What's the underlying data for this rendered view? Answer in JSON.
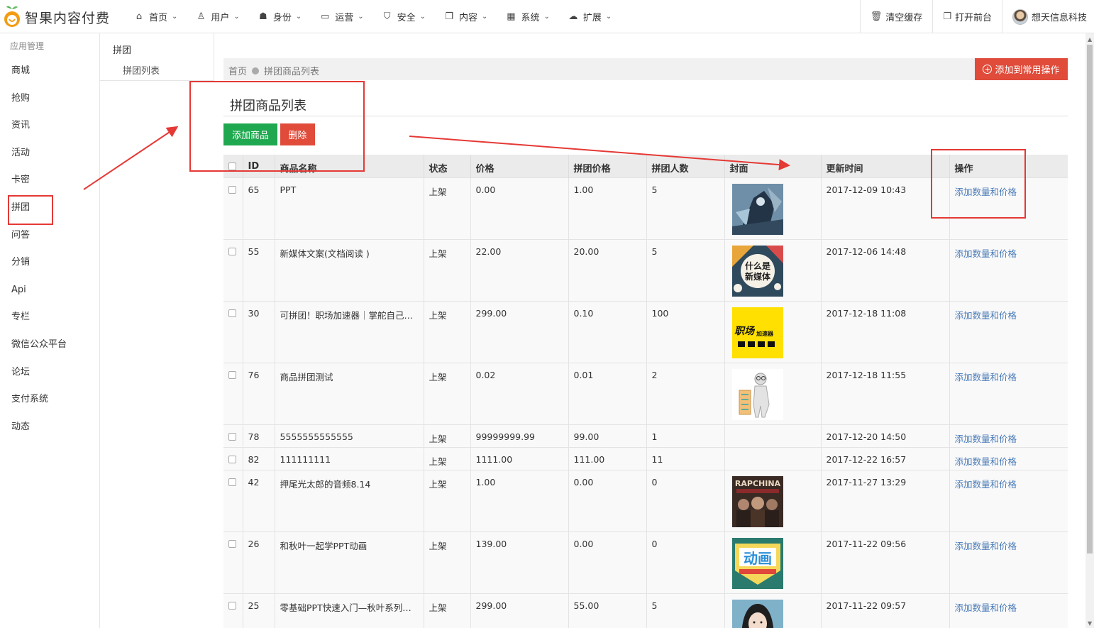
{
  "app": {
    "title": "智果内容付费"
  },
  "nav": [
    {
      "label": "首页",
      "icon": "home-icon",
      "glyph": "⌂"
    },
    {
      "label": "用户",
      "icon": "user-icon",
      "glyph": "♙"
    },
    {
      "label": "身份",
      "icon": "users-icon",
      "glyph": "☗"
    },
    {
      "label": "运营",
      "icon": "monitor-icon",
      "glyph": "▭"
    },
    {
      "label": "安全",
      "icon": "shield-icon",
      "glyph": "⛉"
    },
    {
      "label": "内容",
      "icon": "copy-icon",
      "glyph": "❐"
    },
    {
      "label": "系统",
      "icon": "windows-icon",
      "glyph": "▦"
    },
    {
      "label": "扩展",
      "icon": "cloud-icon",
      "glyph": "☁"
    }
  ],
  "topright": {
    "clear_cache": "清空缓存",
    "open_front": "打开前台",
    "user_name": "想天信息科技"
  },
  "sidebar": {
    "group": "应用管理",
    "items": [
      "商城",
      "抢购",
      "资讯",
      "活动",
      "卡密",
      "拼团",
      "问答",
      "分销",
      "Api",
      "专栏",
      "微信公众平台",
      "论坛",
      "支付系统",
      "动态"
    ],
    "active": "拼团"
  },
  "submenu": {
    "title": "拼团",
    "item": "拼团列表"
  },
  "breadcrumb": {
    "home": "首页",
    "current": "拼团商品列表"
  },
  "quick_action": "添加到常用操作",
  "page": {
    "title": "拼团商品列表",
    "add_button": "添加商品",
    "delete_button": "删除"
  },
  "table": {
    "headers": [
      "ID",
      "商品名称",
      "状态",
      "价格",
      "拼团价格",
      "拼团人数",
      "封面",
      "更新时间",
      "操作"
    ],
    "rows": [
      {
        "id": "65",
        "name": "PPT",
        "status": "上架",
        "price": "0.00",
        "group_price": "1.00",
        "group_size": "5",
        "cover": "anime-art",
        "updated": "2017-12-09 10:43",
        "action": "添加数量和价格"
      },
      {
        "id": "55",
        "name": "新媒体文案(文档阅读 )",
        "status": "上架",
        "price": "22.00",
        "group_price": "20.00",
        "group_size": "5",
        "cover": "new-media",
        "cover_text": "什么是新媒体",
        "updated": "2017-12-06 14:48",
        "action": "添加数量和价格"
      },
      {
        "id": "30",
        "name": "可拼团！职场加速器｜掌舵自己…",
        "status": "上架",
        "price": "299.00",
        "group_price": "0.10",
        "group_size": "100",
        "cover": "career",
        "cover_text": "职场加速器",
        "updated": "2017-12-18 11:08",
        "action": "添加数量和价格"
      },
      {
        "id": "76",
        "name": "商品拼团测试",
        "status": "上架",
        "price": "0.02",
        "group_price": "0.01",
        "group_size": "2",
        "cover": "figure-checklist",
        "updated": "2017-12-18 11:55",
        "action": "添加数量和价格"
      },
      {
        "id": "78",
        "name": "5555555555555",
        "status": "上架",
        "price": "99999999.99",
        "group_price": "99.00",
        "group_size": "1",
        "cover": "",
        "updated": "2017-12-20 14:50",
        "action": "添加数量和价格"
      },
      {
        "id": "82",
        "name": "111111111",
        "status": "上架",
        "price": "1111.00",
        "group_price": "111.00",
        "group_size": "11",
        "cover": "",
        "updated": "2017-12-22 16:57",
        "action": "添加数量和价格"
      },
      {
        "id": "42",
        "name": "押尾光太郎的音频8.14",
        "status": "上架",
        "price": "1.00",
        "group_price": "0.00",
        "group_size": "0",
        "cover": "rap-china",
        "cover_text": "RAPCHINA",
        "updated": "2017-11-27 13:29",
        "action": "添加数量和价格"
      },
      {
        "id": "26",
        "name": "和秋叶一起学PPT动画",
        "status": "上架",
        "price": "139.00",
        "group_price": "0.00",
        "group_size": "0",
        "cover": "animation",
        "cover_text": "动画",
        "updated": "2017-11-22 09:56",
        "action": "添加数量和价格"
      },
      {
        "id": "25",
        "name": "零基础PPT快速入门—秋叶系列…",
        "status": "上架",
        "price": "299.00",
        "group_price": "55.00",
        "group_size": "5",
        "cover": "portrait",
        "updated": "2017-11-22 09:57",
        "action": "添加数量和价格"
      }
    ]
  },
  "colors": {
    "primary_green": "#1fa84f",
    "danger_red": "#e04b3a",
    "link_blue": "#4a7bb8",
    "annotation_red": "#e53935"
  }
}
